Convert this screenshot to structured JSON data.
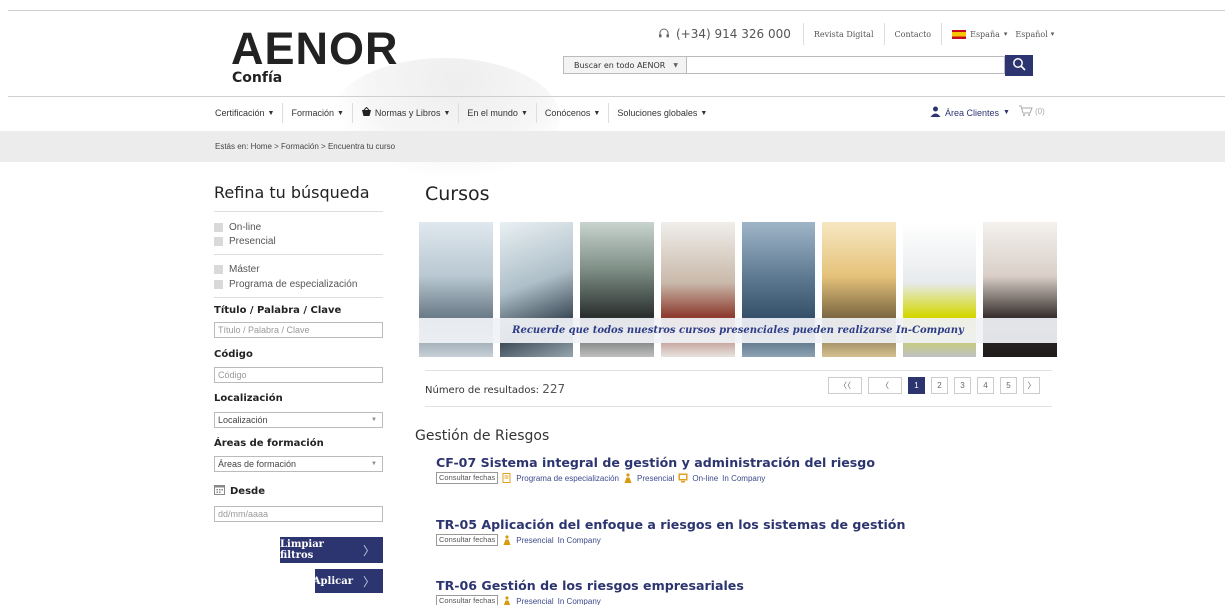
{
  "header": {
    "logo_main": "AENOR",
    "logo_sub": "Confía",
    "phone": "(+34) 914 326 000",
    "links": [
      "Revista Digital",
      "Contacto"
    ],
    "country": "España",
    "language": "Español",
    "search_scope": "Buscar en todo AENOR",
    "search_value": ""
  },
  "nav": {
    "items": [
      "Certificación",
      "Formación",
      "Normas y Libros",
      "En el mundo",
      "Conócenos",
      "Soluciones globales"
    ],
    "clients": "Área Clientes",
    "cart_count": "(0)"
  },
  "breadcrumb": "Estás en: Home  >  Formación  >  Encuentra tu curso",
  "sidebar": {
    "title": "Refina tu búsqueda",
    "modality": [
      "On-line",
      "Presencial"
    ],
    "types": [
      "Máster",
      "Programa de especialización"
    ],
    "title_label": "Título / Palabra / Clave",
    "title_placeholder": "Título / Palabra / Clave",
    "code_label": "Código",
    "code_placeholder": "Código",
    "location_label": "Localización",
    "location_value": "Localización",
    "areas_label": "Áreas de formación",
    "areas_value": "Áreas de formación",
    "from_label": "Desde",
    "from_placeholder": "dd/mm/aaaa",
    "clear_button": "Limpiar filtros",
    "apply_button": "Aplicar"
  },
  "main": {
    "title": "Cursos",
    "banner_text": "Recuerde que todos nuestros cursos presenciales pueden realizarse In-Company",
    "results_label": "Número de resultados:",
    "results_count": "227",
    "pagination": [
      "1",
      "2",
      "3",
      "4",
      "5"
    ],
    "section": "Gestión de Riesgos",
    "consult_label": "Consultar fechas",
    "courses": [
      {
        "title": "CF-07 Sistema integral de gestión y administración del riesgo",
        "tags": [
          "Programa de especialización",
          "Presencial",
          "On-line",
          "In Company"
        ]
      },
      {
        "title": "TR-05 Aplicación del enfoque a riesgos en los sistemas de gestión",
        "tags": [
          "Presencial",
          "In Company"
        ]
      },
      {
        "title": "TR-06 Gestión de los riesgos empresariales",
        "tags": [
          "Presencial",
          "In Company"
        ]
      }
    ]
  },
  "colors": {
    "brand_navy": "#2d3570",
    "link_blue": "#2d3c86",
    "breadcrumb_bg": "#ececec"
  }
}
